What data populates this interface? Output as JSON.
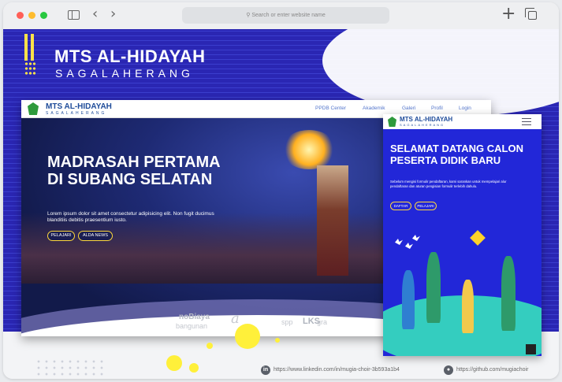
{
  "browser": {
    "url_placeholder": "Search or enter website name",
    "back": "‹",
    "forward": "›",
    "new_tab": "+",
    "colors": {
      "close": "#ff5f57",
      "minimize": "#febc2e",
      "maximize": "#28c840"
    }
  },
  "banner": {
    "title": "MTS AL-HIDAYAH",
    "subtitle": "SAGALAHERANG",
    "accent": "#ffe24a",
    "bg": "#2a26b3"
  },
  "desktop": {
    "brand": "MTS AL-HIDAYAH",
    "brand_sub": "SAGALAHERANG",
    "nav": [
      "PPDB Center",
      "Akademik",
      "Galeri",
      "Profil",
      "Login"
    ],
    "headline": "MADRASAH PERTAMA DI SUBANG SELATAN",
    "body": "Lorem ipsum dolor sit amet consectetur adipisicing elit. Non fugit ducimus blanditiis debitis praesentium iusto.",
    "buttons": [
      "PELAJARI",
      "ALDA NEWS"
    ],
    "partners": [
      "noBiaya",
      "bangunan",
      "a",
      "spp",
      "LKS",
      "gra"
    ]
  },
  "mobile": {
    "brand": "MTS AL-HIDAYAH",
    "brand_sub": "SAGALAHERANG",
    "headline": "SELAMAT DATANG CALON PESERTA DIDIK BARU",
    "body": "Sebelum mengisi formulir pendaftaran, kami sarankan untuk mempelajari alur pendaftaran dan aturan pengisian formulir terlebih dahulu.",
    "buttons": [
      "DAFTAR",
      "PELAJARI"
    ],
    "bg": "#2227d8"
  },
  "footer": {
    "linkedin": "https://www.linkedin.com/in/mugia-choir-3b593a1b4",
    "github": "https://github.com/mugiachoir",
    "linkedin_icon": "in",
    "github_icon": "github-icon"
  }
}
